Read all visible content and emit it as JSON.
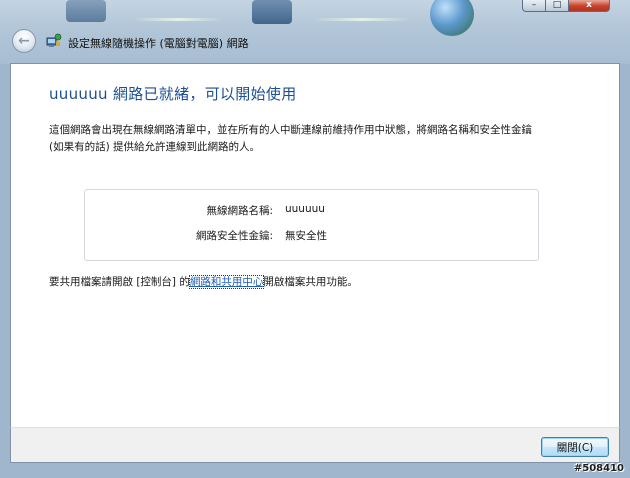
{
  "window": {
    "title": "設定無線隨機操作 (電腦對電腦) 網路",
    "controls": {
      "minimize": "–",
      "maximize": "□",
      "close": "x"
    }
  },
  "icons": {
    "back": "back-arrow-icon",
    "app": "wireless-network-icon",
    "computer_a": "computer-icon",
    "computer_b": "computer-icon",
    "internet": "globe-icon"
  },
  "main": {
    "heading": "uuuuuu 網路已就緒，可以開始使用",
    "description": "這個網路會出現在無線網路清單中，並在所有的人中斷連線前維持作用中狀態，將網路名稱和安全性金鑰 (如果有的話) 提供給允許連線到此網路的人。",
    "network_name_label": "無線網路名稱:",
    "network_name_value": "uuuuuu",
    "security_key_label": "網路安全性金鑰:",
    "security_key_value": "無安全性",
    "share_prefix": "要共用檔案請開啟 [控制台] 的",
    "share_link": "網路和共用中心",
    "share_suffix": "開啟檔案共用功能。"
  },
  "footer": {
    "close_button": "關閉(C)"
  },
  "watermark": "#508410",
  "colors": {
    "heading": "#1d4f91",
    "link": "#1f5fb2",
    "button_border": "#3c7fb1"
  }
}
